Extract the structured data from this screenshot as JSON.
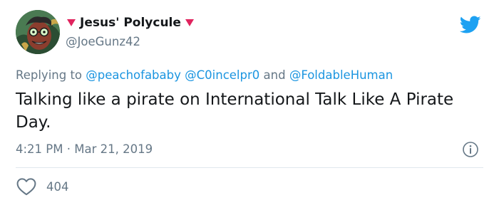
{
  "author": {
    "display_name": "Jesus' Polycule",
    "handle": "@JoeGunz42",
    "avatar": "avatar-illustration"
  },
  "reply": {
    "prefix": "Replying to",
    "mentions": [
      "@peachofababy",
      "@C0incelpr0",
      "@FoldableHuman"
    ],
    "conjunction": "and"
  },
  "tweet": {
    "text": "Talking like a pirate on International Talk Like A Pirate Day.",
    "timestamp": "4:21 PM · Mar 21, 2019"
  },
  "actions": {
    "like_count": "404"
  },
  "icons": {
    "brand": "twitter-bird-icon",
    "info": "info-icon",
    "like": "heart-outline-icon",
    "name_decoration": "heart-icon"
  },
  "colors": {
    "brand_blue": "#1da1f2",
    "mention_blue": "#1b95e0",
    "secondary_text": "#657786",
    "primary_text": "#14171a",
    "heart_pink": "#e0245e",
    "divider": "#e1e8ed"
  }
}
